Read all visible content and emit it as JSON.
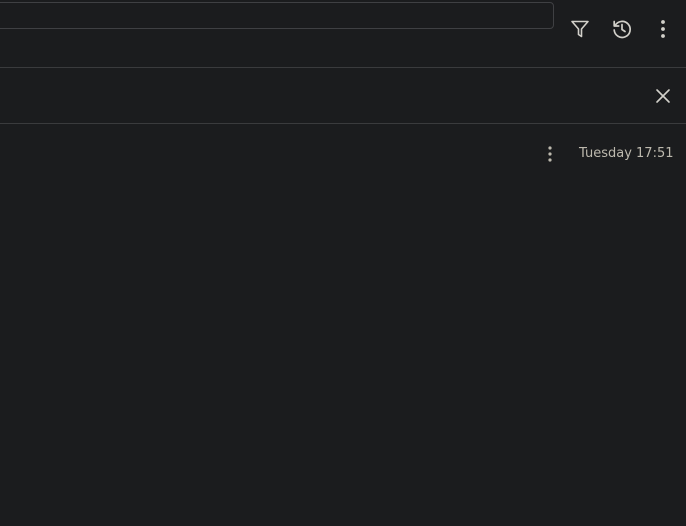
{
  "toolbar": {
    "search_value": "",
    "search_placeholder": "",
    "icons": {
      "filter": "filter-icon",
      "history": "history-icon",
      "more": "more-vertical-icon"
    }
  },
  "subbar": {
    "icons": {
      "close": "close-icon"
    }
  },
  "entry": {
    "timestamp": "Tuesday 17:51",
    "icons": {
      "more": "more-vertical-icon"
    }
  },
  "colors": {
    "background": "#1b1c1e",
    "divider": "#3a3b3d",
    "icon": "#d2d0ca",
    "timestamp_text": "#bdb9ae"
  }
}
